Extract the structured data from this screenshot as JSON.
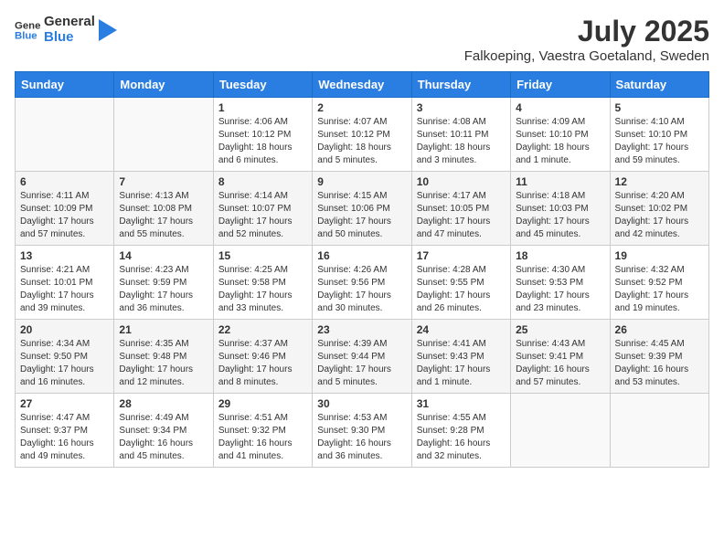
{
  "logo": {
    "line1": "General",
    "line2": "Blue"
  },
  "title": "July 2025",
  "subtitle": "Falkoeping, Vaestra Goetaland, Sweden",
  "days_of_week": [
    "Sunday",
    "Monday",
    "Tuesday",
    "Wednesday",
    "Thursday",
    "Friday",
    "Saturday"
  ],
  "weeks": [
    [
      {
        "day": "",
        "info": ""
      },
      {
        "day": "",
        "info": ""
      },
      {
        "day": "1",
        "info": "Sunrise: 4:06 AM\nSunset: 10:12 PM\nDaylight: 18 hours and 6 minutes."
      },
      {
        "day": "2",
        "info": "Sunrise: 4:07 AM\nSunset: 10:12 PM\nDaylight: 18 hours and 5 minutes."
      },
      {
        "day": "3",
        "info": "Sunrise: 4:08 AM\nSunset: 10:11 PM\nDaylight: 18 hours and 3 minutes."
      },
      {
        "day": "4",
        "info": "Sunrise: 4:09 AM\nSunset: 10:10 PM\nDaylight: 18 hours and 1 minute."
      },
      {
        "day": "5",
        "info": "Sunrise: 4:10 AM\nSunset: 10:10 PM\nDaylight: 17 hours and 59 minutes."
      }
    ],
    [
      {
        "day": "6",
        "info": "Sunrise: 4:11 AM\nSunset: 10:09 PM\nDaylight: 17 hours and 57 minutes."
      },
      {
        "day": "7",
        "info": "Sunrise: 4:13 AM\nSunset: 10:08 PM\nDaylight: 17 hours and 55 minutes."
      },
      {
        "day": "8",
        "info": "Sunrise: 4:14 AM\nSunset: 10:07 PM\nDaylight: 17 hours and 52 minutes."
      },
      {
        "day": "9",
        "info": "Sunrise: 4:15 AM\nSunset: 10:06 PM\nDaylight: 17 hours and 50 minutes."
      },
      {
        "day": "10",
        "info": "Sunrise: 4:17 AM\nSunset: 10:05 PM\nDaylight: 17 hours and 47 minutes."
      },
      {
        "day": "11",
        "info": "Sunrise: 4:18 AM\nSunset: 10:03 PM\nDaylight: 17 hours and 45 minutes."
      },
      {
        "day": "12",
        "info": "Sunrise: 4:20 AM\nSunset: 10:02 PM\nDaylight: 17 hours and 42 minutes."
      }
    ],
    [
      {
        "day": "13",
        "info": "Sunrise: 4:21 AM\nSunset: 10:01 PM\nDaylight: 17 hours and 39 minutes."
      },
      {
        "day": "14",
        "info": "Sunrise: 4:23 AM\nSunset: 9:59 PM\nDaylight: 17 hours and 36 minutes."
      },
      {
        "day": "15",
        "info": "Sunrise: 4:25 AM\nSunset: 9:58 PM\nDaylight: 17 hours and 33 minutes."
      },
      {
        "day": "16",
        "info": "Sunrise: 4:26 AM\nSunset: 9:56 PM\nDaylight: 17 hours and 30 minutes."
      },
      {
        "day": "17",
        "info": "Sunrise: 4:28 AM\nSunset: 9:55 PM\nDaylight: 17 hours and 26 minutes."
      },
      {
        "day": "18",
        "info": "Sunrise: 4:30 AM\nSunset: 9:53 PM\nDaylight: 17 hours and 23 minutes."
      },
      {
        "day": "19",
        "info": "Sunrise: 4:32 AM\nSunset: 9:52 PM\nDaylight: 17 hours and 19 minutes."
      }
    ],
    [
      {
        "day": "20",
        "info": "Sunrise: 4:34 AM\nSunset: 9:50 PM\nDaylight: 17 hours and 16 minutes."
      },
      {
        "day": "21",
        "info": "Sunrise: 4:35 AM\nSunset: 9:48 PM\nDaylight: 17 hours and 12 minutes."
      },
      {
        "day": "22",
        "info": "Sunrise: 4:37 AM\nSunset: 9:46 PM\nDaylight: 17 hours and 8 minutes."
      },
      {
        "day": "23",
        "info": "Sunrise: 4:39 AM\nSunset: 9:44 PM\nDaylight: 17 hours and 5 minutes."
      },
      {
        "day": "24",
        "info": "Sunrise: 4:41 AM\nSunset: 9:43 PM\nDaylight: 17 hours and 1 minute."
      },
      {
        "day": "25",
        "info": "Sunrise: 4:43 AM\nSunset: 9:41 PM\nDaylight: 16 hours and 57 minutes."
      },
      {
        "day": "26",
        "info": "Sunrise: 4:45 AM\nSunset: 9:39 PM\nDaylight: 16 hours and 53 minutes."
      }
    ],
    [
      {
        "day": "27",
        "info": "Sunrise: 4:47 AM\nSunset: 9:37 PM\nDaylight: 16 hours and 49 minutes."
      },
      {
        "day": "28",
        "info": "Sunrise: 4:49 AM\nSunset: 9:34 PM\nDaylight: 16 hours and 45 minutes."
      },
      {
        "day": "29",
        "info": "Sunrise: 4:51 AM\nSunset: 9:32 PM\nDaylight: 16 hours and 41 minutes."
      },
      {
        "day": "30",
        "info": "Sunrise: 4:53 AM\nSunset: 9:30 PM\nDaylight: 16 hours and 36 minutes."
      },
      {
        "day": "31",
        "info": "Sunrise: 4:55 AM\nSunset: 9:28 PM\nDaylight: 16 hours and 32 minutes."
      },
      {
        "day": "",
        "info": ""
      },
      {
        "day": "",
        "info": ""
      }
    ]
  ]
}
